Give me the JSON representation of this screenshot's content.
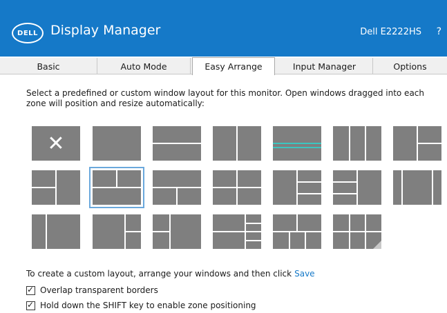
{
  "header": {
    "logo": "DELL",
    "title": "Display Manager",
    "model": "Dell E2222HS",
    "help": "?"
  },
  "tabs": [
    {
      "label": "Basic"
    },
    {
      "label": "Auto Mode"
    },
    {
      "label": "Easy Arrange"
    },
    {
      "label": "Input Manager"
    },
    {
      "label": "Options"
    }
  ],
  "description": "Select a predefined or custom window layout for this monitor.  Open windows dragged into each zone will position and resize automatically:",
  "footer": {
    "custom_text": "To create a custom layout, arrange your windows and then click",
    "save_label": "Save",
    "overlap_label": "Overlap transparent borders",
    "shift_label": "Hold down the SHIFT key to enable zone positioning"
  },
  "colors": {
    "header": "#1579c8",
    "zone": "#7f7f7f",
    "accent": "#1579c8",
    "teal": "#3cc6c0"
  }
}
